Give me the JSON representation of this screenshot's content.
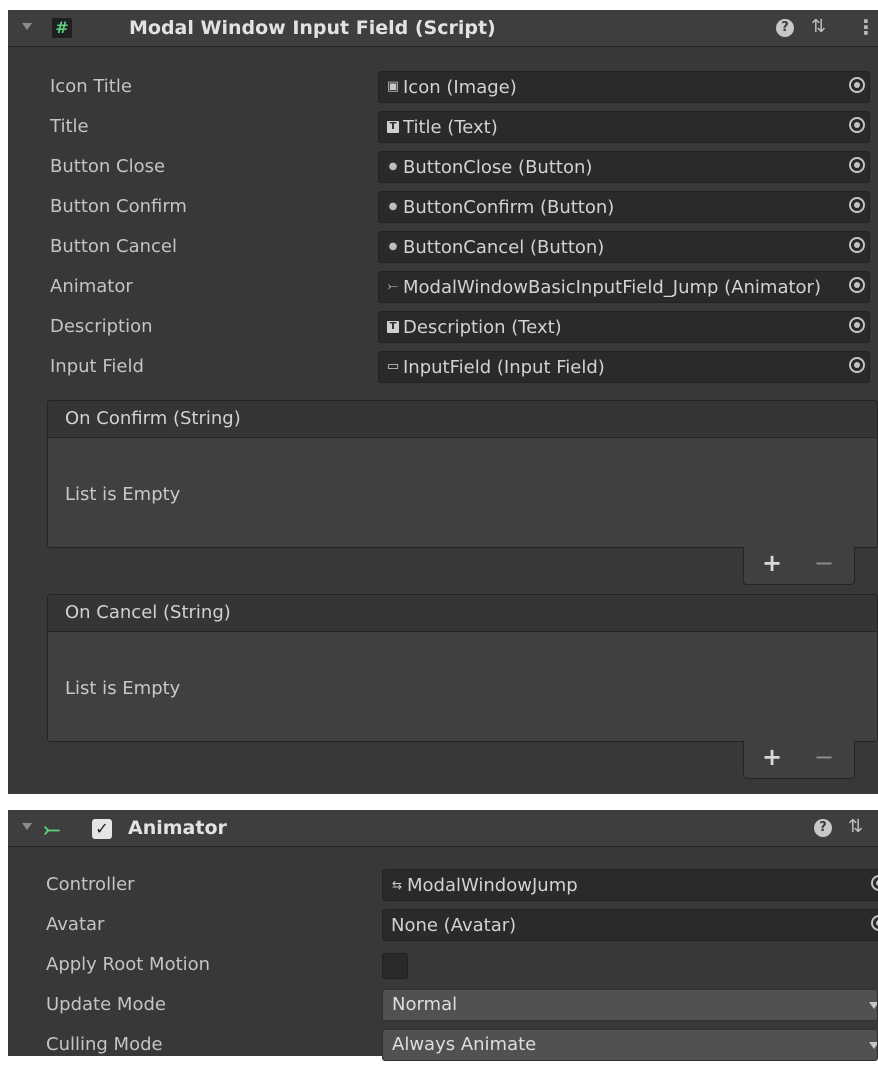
{
  "script_component": {
    "title": "Modal Window Input Field (Script)",
    "icon": "script-icon",
    "fields": [
      {
        "label": "Icon Title",
        "value": "Icon (Image)",
        "icon": "image-icon"
      },
      {
        "label": "Title",
        "value": "Title (Text)",
        "icon": "text-icon"
      },
      {
        "label": "Button Close",
        "value": "ButtonClose (Button)",
        "icon": "button-icon"
      },
      {
        "label": "Button Confirm",
        "value": "ButtonConfirm (Button)",
        "icon": "button-icon"
      },
      {
        "label": "Button Cancel",
        "value": "ButtonCancel (Button)",
        "icon": "button-icon"
      },
      {
        "label": "Animator",
        "value": "ModalWindowBasicInputField_Jump (Animator)",
        "icon": "animator-icon"
      },
      {
        "label": "Description",
        "value": "Description (Text)",
        "icon": "text-icon"
      },
      {
        "label": "Input Field",
        "value": "InputField (Input Field)",
        "icon": "input-field-icon"
      }
    ],
    "events": [
      {
        "title": "On Confirm (String)",
        "empty_text": "List is Empty",
        "add": "+",
        "remove": "−"
      },
      {
        "title": "On Cancel (String)",
        "empty_text": "List is Empty",
        "add": "+",
        "remove": "−"
      }
    ]
  },
  "animator_component": {
    "title": "Animator",
    "enabled": true,
    "fields": {
      "controller": {
        "label": "Controller",
        "value": "ModalWindowJump",
        "icon": "animator-controller-icon"
      },
      "avatar": {
        "label": "Avatar",
        "value": "None (Avatar)"
      },
      "apply_root_motion": {
        "label": "Apply Root Motion",
        "checked": false
      },
      "update_mode": {
        "label": "Update Mode",
        "value": "Normal"
      },
      "culling_mode": {
        "label": "Culling Mode",
        "value": "Always Animate"
      }
    }
  },
  "glyphs": {
    "script": "#",
    "help": "?",
    "preset": "⇅",
    "kebab": "⋮",
    "image": "▣",
    "text": "T",
    "button": "●",
    "animator": "⤚",
    "input_field": "▭",
    "controller": "⇆",
    "check": "✓"
  },
  "colors": {
    "panel_bg": "#383838",
    "header_bg": "#3e3e3e",
    "field_bg": "#2a2a2a",
    "script_icon_green": "#5fce7e",
    "dropdown_bg": "#515151"
  }
}
